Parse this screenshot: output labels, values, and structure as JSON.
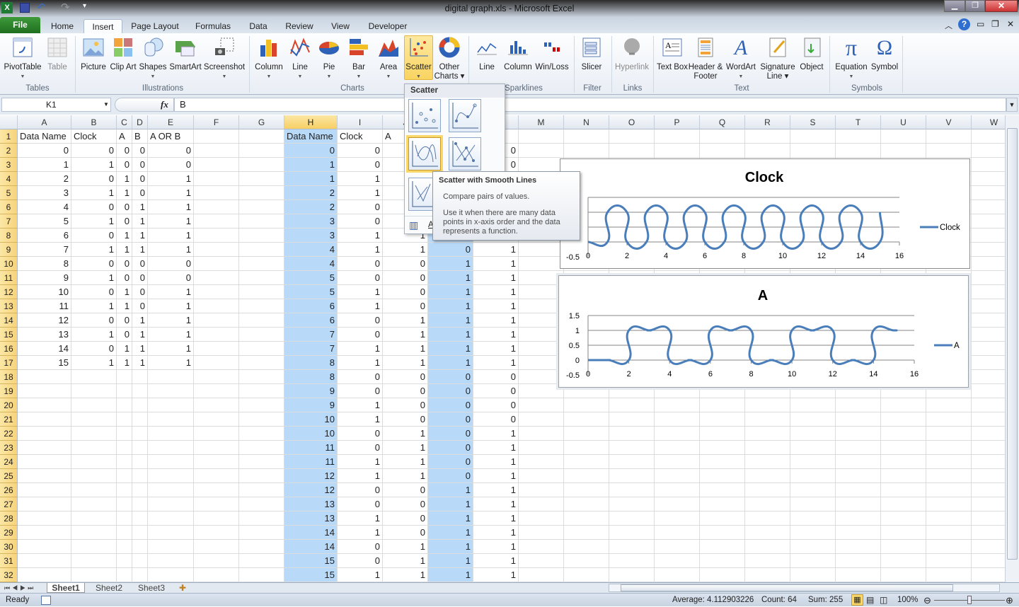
{
  "window": {
    "title": "digital graph.xls  -  Microsoft Excel"
  },
  "tabs": [
    "File",
    "Home",
    "Insert",
    "Page Layout",
    "Formulas",
    "Data",
    "Review",
    "View",
    "Developer"
  ],
  "active_tab": "Insert",
  "ribbon": {
    "buttons": [
      "PivotTable",
      "Table",
      "Picture",
      "Clip Art",
      "Shapes",
      "SmartArt",
      "Screenshot",
      "Column",
      "Line",
      "Pie",
      "Bar",
      "Area",
      "Scatter",
      "Other Charts",
      "Line",
      "Column",
      "Win/Loss",
      "Slicer",
      "Hyperlink",
      "Text Box",
      "Header & Footer",
      "WordArt",
      "Signature Line",
      "Object",
      "Equation",
      "Symbol"
    ],
    "groups": [
      "Tables",
      "Illustrations",
      "Charts",
      "Sparklines",
      "Filter",
      "Links",
      "Text",
      "Symbols"
    ]
  },
  "formula_bar": {
    "name_box": "K1",
    "fx": "fx",
    "value": "B"
  },
  "sheet": {
    "columns": [
      "A",
      "B",
      "C",
      "D",
      "E",
      "F",
      "G",
      "H",
      "I",
      "J",
      "K",
      "L",
      "M",
      "N",
      "O",
      "P",
      "Q",
      "R",
      "S",
      "T",
      "U",
      "V",
      "W"
    ],
    "row_numbers": [
      1,
      2,
      3,
      4,
      5,
      6,
      7,
      8,
      9,
      10,
      11,
      12,
      13,
      14,
      15,
      16,
      17,
      18,
      19,
      20,
      21,
      22,
      23,
      24,
      25,
      26,
      27,
      28,
      29,
      30,
      31,
      32
    ],
    "left_table": {
      "headers": [
        "Data Name",
        "Clock",
        "A",
        "B",
        "A OR B"
      ],
      "rows": [
        [
          0,
          0,
          0,
          0,
          0
        ],
        [
          1,
          1,
          0,
          0,
          0
        ],
        [
          2,
          0,
          1,
          0,
          1
        ],
        [
          3,
          1,
          1,
          0,
          1
        ],
        [
          4,
          0,
          0,
          1,
          1
        ],
        [
          5,
          1,
          0,
          1,
          1
        ],
        [
          6,
          0,
          1,
          1,
          1
        ],
        [
          7,
          1,
          1,
          1,
          1
        ],
        [
          8,
          0,
          0,
          0,
          0
        ],
        [
          9,
          1,
          0,
          0,
          0
        ],
        [
          10,
          0,
          1,
          0,
          1
        ],
        [
          11,
          1,
          1,
          0,
          1
        ],
        [
          12,
          0,
          0,
          1,
          1
        ],
        [
          13,
          1,
          0,
          1,
          1
        ],
        [
          14,
          0,
          1,
          1,
          1
        ],
        [
          15,
          1,
          1,
          1,
          1
        ]
      ]
    },
    "right_table": {
      "headers": [
        "Data Name",
        "Clock",
        "A",
        null,
        null
      ],
      "rows": [
        [
          0,
          0,
          null,
          null,
          0
        ],
        [
          1,
          0,
          null,
          null,
          0
        ],
        [
          1,
          1,
          null,
          null,
          null
        ],
        [
          2,
          1,
          null,
          null,
          null
        ],
        [
          2,
          0,
          null,
          null,
          null
        ],
        [
          3,
          0,
          null,
          null,
          null
        ],
        [
          3,
          1,
          1,
          null,
          null
        ],
        [
          4,
          1,
          1,
          0,
          1
        ],
        [
          4,
          0,
          0,
          1,
          1
        ],
        [
          5,
          0,
          0,
          1,
          1
        ],
        [
          5,
          1,
          0,
          1,
          1
        ],
        [
          6,
          1,
          0,
          1,
          1
        ],
        [
          6,
          0,
          1,
          1,
          1
        ],
        [
          7,
          0,
          1,
          1,
          1
        ],
        [
          7,
          1,
          1,
          1,
          1
        ],
        [
          8,
          1,
          1,
          1,
          1
        ],
        [
          8,
          0,
          0,
          0,
          0
        ],
        [
          9,
          0,
          0,
          0,
          0
        ],
        [
          9,
          1,
          0,
          0,
          0
        ],
        [
          10,
          1,
          0,
          0,
          0
        ],
        [
          10,
          0,
          1,
          0,
          1
        ],
        [
          11,
          0,
          1,
          0,
          1
        ],
        [
          11,
          1,
          1,
          0,
          1
        ],
        [
          12,
          1,
          1,
          0,
          1
        ],
        [
          12,
          0,
          0,
          1,
          1
        ],
        [
          13,
          0,
          0,
          1,
          1
        ],
        [
          13,
          1,
          0,
          1,
          1
        ],
        [
          14,
          1,
          0,
          1,
          1
        ],
        [
          14,
          0,
          1,
          1,
          1
        ],
        [
          15,
          0,
          1,
          1,
          1
        ],
        [
          15,
          1,
          1,
          1,
          1
        ]
      ]
    },
    "sheet_tabs": [
      "Sheet1",
      "Sheet2",
      "Sheet3"
    ],
    "active_sheet": "Sheet1"
  },
  "gallery": {
    "title": "Scatter",
    "footer_label": "A"
  },
  "tooltip": {
    "title": "Scatter with Smooth Lines",
    "line1": "Compare pairs of values.",
    "line2": "Use it when there are many data points in x-axis order and the data represents a function."
  },
  "status": {
    "ready": "Ready",
    "average": "Average: 4.112903226",
    "count": "Count: 64",
    "sum": "Sum: 255",
    "zoom": "100%",
    "zoom_level": 100
  },
  "colors": {
    "series": "#4a7ebb",
    "selection": "#b8d9f8",
    "header_highlight": "#f7cf63",
    "file_tab": "#2a7d2a"
  },
  "chart_data": [
    {
      "type": "scatter",
      "subtype": "smooth-lines",
      "title": "Clock",
      "legend": "right",
      "grid": true,
      "xlim": [
        0,
        16
      ],
      "ylim": [
        -0.5,
        1.5
      ],
      "xticks": [
        0,
        2,
        4,
        6,
        8,
        10,
        12,
        14,
        16
      ],
      "yticks_visible": [
        "-0.5"
      ],
      "series": [
        {
          "name": "Clock",
          "x": [
            0,
            1,
            1,
            2,
            2,
            3,
            3,
            4,
            4,
            5,
            5,
            6,
            6,
            7,
            7,
            8,
            8,
            9,
            9,
            10,
            10,
            11,
            11,
            12,
            12,
            13,
            13,
            14,
            14,
            15,
            15
          ],
          "y": [
            0,
            0,
            1,
            1,
            0,
            0,
            1,
            1,
            0,
            0,
            1,
            1,
            0,
            0,
            1,
            1,
            0,
            0,
            1,
            1,
            0,
            0,
            1,
            1,
            0,
            0,
            1,
            1,
            0,
            0,
            1
          ]
        }
      ]
    },
    {
      "type": "scatter",
      "subtype": "smooth-lines",
      "title": "A",
      "legend": "right",
      "grid": true,
      "xlim": [
        0,
        16
      ],
      "ylim": [
        -0.5,
        1.5
      ],
      "xticks": [
        0,
        2,
        4,
        6,
        8,
        10,
        12,
        14,
        16
      ],
      "yticks_visible": [
        "-0.5",
        "0",
        "0.5",
        "1",
        "1.5"
      ],
      "series": [
        {
          "name": "A",
          "x": [
            0,
            1,
            1,
            2,
            2,
            3,
            3,
            4,
            4,
            5,
            5,
            6,
            6,
            7,
            7,
            8,
            8,
            9,
            9,
            10,
            10,
            11,
            11,
            12,
            12,
            13,
            13,
            14,
            14,
            15,
            15
          ],
          "y": [
            0,
            0,
            0,
            0,
            1,
            1,
            1,
            1,
            0,
            0,
            0,
            0,
            1,
            1,
            1,
            1,
            0,
            0,
            0,
            0,
            1,
            1,
            1,
            1,
            0,
            0,
            0,
            0,
            1,
            1,
            1
          ]
        }
      ]
    }
  ]
}
